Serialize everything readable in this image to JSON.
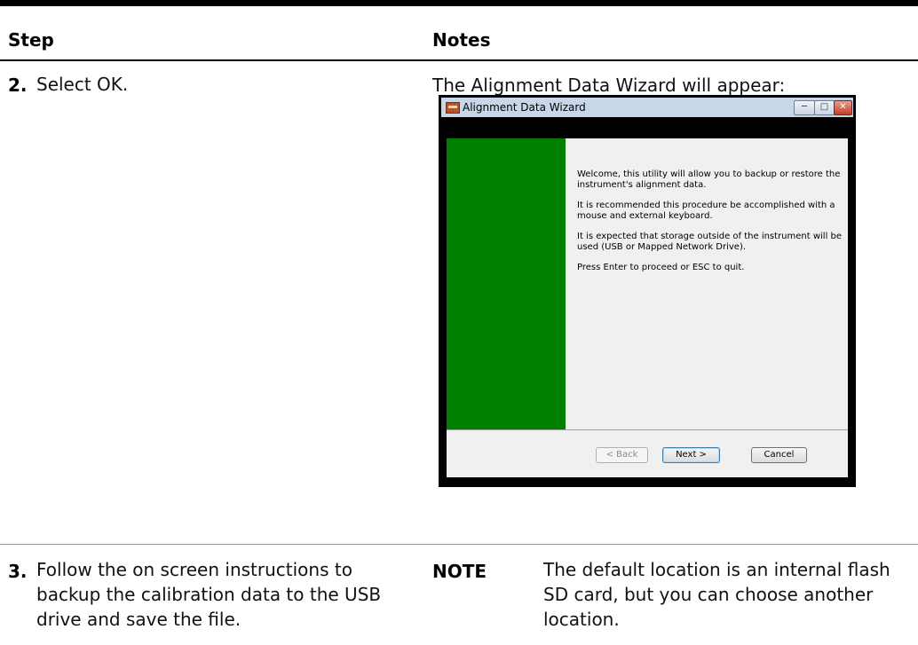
{
  "table": {
    "header": {
      "step": "Step",
      "notes": "Notes"
    },
    "rows": [
      {
        "num": "2.",
        "step": "Select OK.",
        "note": "The Alignment Data Wizard will appear:"
      },
      {
        "num": "3.",
        "step": "Follow the on screen instructions to backup the calibration data to the USB drive and save the file.",
        "note_label": "NOTE",
        "note": "The default location is an internal flash SD card, but you can choose another location."
      }
    ]
  },
  "wizard": {
    "title": "Alignment Data Wizard",
    "paragraphs": [
      "Welcome, this utility will allow you to backup or restore the instrument's alignment data.",
      "It is recommended this procedure be accomplished with a mouse and external keyboard.",
      "It is expected that storage outside of the instrument will be used (USB or Mapped Network Drive).",
      "Press Enter to proceed or ESC to quit."
    ],
    "buttons": {
      "back": "< Back",
      "next": "Next >",
      "cancel": "Cancel"
    },
    "colors": {
      "side_panel": "#008000",
      "content_bg": "#f0f0f0"
    }
  }
}
